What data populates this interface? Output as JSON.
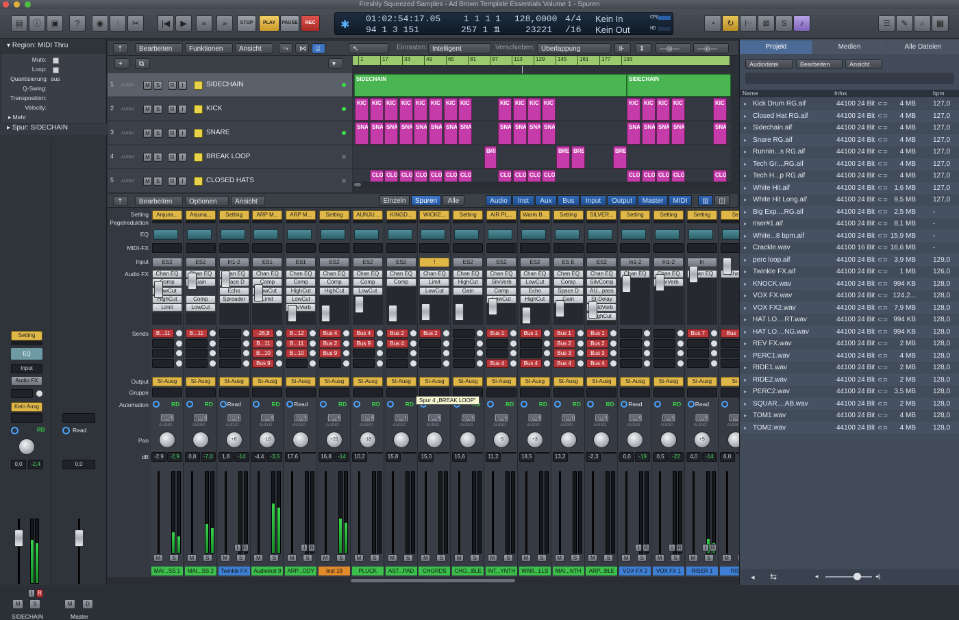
{
  "window": {
    "title": "Freshly Squeezed Samples - Ad Brown Template Essentials Volume 1 - Spuren"
  },
  "transport": {
    "stop": "STOP",
    "play": "PLAY",
    "pause": "PAUSE",
    "rec": "REC",
    "time": "01:02:54:17.05",
    "bars": "94 1 3 151",
    "pos_a": "1 1 1",
    "pos_a2": "1",
    "pos_b": "257 1 1",
    "pos_b2": "1",
    "tempo": "128,0000",
    "sample": "23221",
    "sig": "4/4",
    "div": "/16",
    "in": "Kein In",
    "out": "Kein Out",
    "cpu": "CPU",
    "hd": "HD"
  },
  "inspector": {
    "region_title": "Region: MIDI Thru",
    "mute": "Mute:",
    "loop": "Loop:",
    "quant": "Quantisierung",
    "quant_val": "aus",
    "qswing": "Q-Swing:",
    "transp": "Transposition:",
    "velocity": "Velocity:",
    "more": "Mehr",
    "track_title": "Spur: SIDECHAIN",
    "setting": "Setting",
    "eq": "EQ",
    "input": "Input",
    "audiofx": "Audio FX",
    "output": "Kein Ausg",
    "rd": "RD",
    "read": "Read",
    "vol1": "0,0",
    "vol1b": "-2,4",
    "vol2": "0,0",
    "m": "M",
    "s": "S",
    "d": "D",
    "i": "I",
    "r": "R",
    "name1": "SIDECHAIN",
    "name2": "Master"
  },
  "tracks_toolbar": {
    "edit": "Bearbeiten",
    "functions": "Funktionen",
    "view": "Ansicht",
    "snap_label": "Einrasten:",
    "snap_val": "Intelligent",
    "move_label": "Verschieben:",
    "move_val": "Überlappung"
  },
  "ruler": [
    "1",
    "17",
    "33",
    "49",
    "65",
    "81",
    "97",
    "113",
    "129",
    "145",
    "161",
    "177",
    "193"
  ],
  "tracks": [
    {
      "num": "1",
      "name": "SIDECHAIN"
    },
    {
      "num": "2",
      "name": "KICK"
    },
    {
      "num": "3",
      "name": "SNARE"
    },
    {
      "num": "4",
      "name": "BREAK LOOP"
    },
    {
      "num": "5",
      "name": "CLOSED HATS"
    }
  ],
  "track_btns": {
    "m": "M",
    "s": "S",
    "r": "R",
    "i": "I",
    "audio": "AUDIO"
  },
  "regions": {
    "sidechain": "SIDECHAIN",
    "kick": "KIC",
    "snare": "SNA",
    "brk": "BRE",
    "clo": "CLO",
    "bri": "BRI"
  },
  "mixer_toolbar": {
    "edit": "Bearbeiten",
    "options": "Optionen",
    "view": "Ansicht",
    "single": "Einzeln",
    "tracks": "Spuren",
    "all": "Alle",
    "f_audio": "Audio",
    "f_inst": "Inst",
    "f_aux": "Aux",
    "f_bus": "Bus",
    "f_input": "Input",
    "f_output": "Output",
    "f_master": "Master",
    "f_midi": "MIDI"
  },
  "mixer_rows": {
    "setting": "Setting",
    "gain": "Pegelreduktion",
    "eq": "EQ",
    "midifx": "MIDI-FX",
    "input": "Input",
    "audiofx": "Audio FX",
    "sends": "Sends",
    "output": "Output",
    "group": "Gruppe",
    "automation": "Automation",
    "pan": "Pan",
    "db": "dB"
  },
  "strips": [
    {
      "setting": "Anjuna...",
      "input": "ES2",
      "fx": [
        "Chan EQ",
        "Comp",
        "LowCut",
        "HighCut",
        "Limit"
      ],
      "sends": [
        "B...11",
        "",
        "",
        ""
      ],
      "out": "St-Ausg",
      "auto": "RD",
      "pan": "",
      "db1": "-2,9",
      "db2": "-2,9",
      "name": "MAI...SS 1",
      "color": "#3cbf4a"
    },
    {
      "setting": "Anjuna...",
      "input": "ES2",
      "fx": [
        "Chan EQ",
        "Gain",
        "",
        "Comp",
        "LowCut"
      ],
      "sends": [
        "B...11",
        "",
        "",
        ""
      ],
      "out": "St-Ausg",
      "auto": "RD",
      "pan": "",
      "db1": "0,8",
      "db2": "-7,0",
      "name": "MAI...SS 2",
      "color": "#3cbf4a"
    },
    {
      "setting": "Setting",
      "input": "In1-2",
      "fx": [
        "Chan EQ",
        "Space D",
        "Echo",
        "Spreader"
      ],
      "sends": [
        "",
        "",
        "",
        ""
      ],
      "out": "St-Ausg",
      "auto": "Read",
      "pan": "+6",
      "db1": "1,8",
      "db2": "-14",
      "name": "Twinkle FX",
      "color": "#3e7fd6"
    },
    {
      "setting": "ARP M...",
      "input": "ES1",
      "fx": [
        "Chan EQ",
        "Comp",
        "LowCut",
        "Limit"
      ],
      "sends": [
        "-26,8",
        "B...11",
        "B...10",
        "Bus 9"
      ],
      "out": "St-Ausg",
      "auto": "RD",
      "pan": "-10",
      "db1": "-4,4",
      "db2": "-3,5",
      "name": "AudioInst 9",
      "color": "#3cbf4a"
    },
    {
      "setting": "ARP M...",
      "input": "ES1",
      "fx": [
        "Chan EQ",
        "Comp",
        "HighCut",
        "LowCut",
        "SilvVerb"
      ],
      "sends": [
        "B...12",
        "B...11",
        "B...10",
        ""
      ],
      "out": "St-Ausg",
      "auto": "Read",
      "pan": "",
      "db1": "17,6",
      "db2": "",
      "name": "ARP...ODY",
      "color": "#3cbf4a"
    },
    {
      "setting": "Setting",
      "input": "ES2",
      "fx": [
        "Chan EQ",
        "Comp",
        "HighCut"
      ],
      "sends": [
        "Bus 4",
        "Bus 2",
        "Bus 9",
        ""
      ],
      "out": "St-Ausg",
      "auto": "RD",
      "pan": "+21",
      "db1": "16,8",
      "db2": "-14",
      "name": "Inst 19",
      "color": "#e08a2a"
    },
    {
      "setting": "AUNJU...",
      "input": "ES2",
      "fx": [
        "Chan EQ",
        "Comp",
        "LowCut"
      ],
      "sends": [
        "Bus 4",
        "Bus 9",
        "",
        ""
      ],
      "out": "St-Ausg",
      "auto": "RD",
      "pan": "-18",
      "db1": "10,2",
      "db2": "",
      "name": "PLUCK",
      "color": "#3cbf4a"
    },
    {
      "setting": "KINGD...",
      "input": "ES2",
      "fx": [
        "Chan EQ",
        "Comp"
      ],
      "sends": [
        "Bus 2",
        "Bus 4",
        "",
        ""
      ],
      "out": "St-Ausg",
      "auto": "RD",
      "pan": "",
      "db1": "15,8",
      "db2": "",
      "name": "AST...PAD",
      "color": "#3cbf4a"
    },
    {
      "setting": "WICKE...",
      "input": "!",
      "fx": [
        "Chan EQ",
        "Limit",
        "LowCut"
      ],
      "sends": [
        "Bus 2",
        "",
        "",
        ""
      ],
      "out": "St-Ausg",
      "auto": "",
      "pan": "",
      "db1": "15,0",
      "db2": "",
      "name": "CHORDS",
      "color": "#3cbf4a"
    },
    {
      "setting": "Setting",
      "input": "ES2",
      "fx": [
        "Chan EQ",
        "HighCut",
        "Gain"
      ],
      "sends": [
        "",
        "",
        "",
        ""
      ],
      "out": "St-Ausg",
      "auto": "RD",
      "pan": "",
      "db1": "15,6",
      "db2": "",
      "name": "CHO...BLE",
      "color": "#3cbf4a"
    },
    {
      "setting": "AIR PL...",
      "input": "ES2",
      "fx": [
        "Chan EQ",
        "SilvVerb",
        "Comp",
        "LowCut"
      ],
      "sends": [
        "Bus 1",
        "",
        "",
        "Bus 4"
      ],
      "out": "St-Ausg",
      "auto": "RD",
      "pan": "-5",
      "db1": "11,2",
      "db2": "",
      "name": "INT...YNTH",
      "color": "#3cbf4a"
    },
    {
      "setting": "Warm B...",
      "input": "ES2",
      "fx": [
        "Chan EQ",
        "LowCut",
        "Echo",
        "HighCut"
      ],
      "sends": [
        "Bus 1",
        "",
        "",
        "Bus 4"
      ],
      "out": "St-Ausg",
      "auto": "RD",
      "pan": "+3",
      "db1": "18,5",
      "db2": "",
      "name": "WAR...LLS",
      "color": "#3cbf4a"
    },
    {
      "setting": "Setting",
      "input": "ES E",
      "fx": [
        "Chan EQ",
        "Comp",
        "Space D",
        "Gain"
      ],
      "sends": [
        "Bus 1",
        "Bus 2",
        "Bus 3",
        "Bus 4"
      ],
      "out": "St-Ausg",
      "auto": "RD",
      "pan": "",
      "db1": "13,2",
      "db2": "",
      "name": "MAI...NTH",
      "color": "#3cbf4a"
    },
    {
      "setting": "SILVER...",
      "input": "ES2",
      "fx": [
        "Chan EQ",
        "SilvComp",
        "AU...pass",
        "St-Delay",
        "GoldVerb",
        "HighCut"
      ],
      "sends": [
        "Bus 1",
        "Bus 2",
        "Bus 3",
        "Bus 4"
      ],
      "out": "St-Ausg",
      "auto": "RD",
      "pan": "",
      "db1": "-2,3",
      "db2": "",
      "name": "ARP...BLE",
      "color": "#3cbf4a"
    },
    {
      "setting": "Setting",
      "input": "In1-2",
      "fx": [
        "Chan EQ"
      ],
      "sends": [
        "",
        "",
        "",
        ""
      ],
      "out": "St-Ausg",
      "auto": "Read",
      "pan": "",
      "db1": "0,0",
      "db2": "-19",
      "name": "VOX FX 2",
      "color": "#3e7fd6"
    },
    {
      "setting": "Setting",
      "input": "In1-2",
      "fx": [
        "Chan EQ",
        "SilvVerb"
      ],
      "sends": [
        "",
        "",
        "",
        ""
      ],
      "out": "St-Ausg",
      "auto": "RD",
      "pan": "",
      "db1": "0,5",
      "db2": "-22",
      "name": "VOX FX 1",
      "color": "#3e7fd6"
    },
    {
      "setting": "Setting",
      "input": "In",
      "fx": [
        "Chan EQ"
      ],
      "sends": [
        "Bus 7",
        "",
        "",
        ""
      ],
      "out": "St-Ausg",
      "auto": "Read",
      "pan": "+5",
      "db1": "4,0",
      "db2": "-14",
      "name": "RISER 1",
      "color": "#3e7fd6"
    },
    {
      "setting": "Se",
      "input": "",
      "fx": [
        "Chan"
      ],
      "sends": [
        "Bus",
        "",
        "",
        ""
      ],
      "out": "St-",
      "auto": "",
      "pan": "",
      "db1": "6,0",
      "db2": "",
      "name": "RIS",
      "color": "#3e7fd6"
    }
  ],
  "strip_btns": {
    "m": "M",
    "s": "S",
    "i": "I",
    "r": "R",
    "audio": "AUDIO",
    "midi": "MIDI"
  },
  "tooltip": "Spur 4 „BREAK LOOP“",
  "browser": {
    "tabs": [
      "Projekt",
      "Medien",
      "Alle Dateien"
    ],
    "menus": [
      "Audiodatei",
      "Bearbeiten",
      "Ansicht"
    ],
    "cols": [
      "Name",
      "Infos",
      "bpm"
    ],
    "files": [
      {
        "name": "Kick Drum RG.aif",
        "info": "44100 24 Bit",
        "size": "4 MB",
        "bpm": "127,0"
      },
      {
        "name": "Closed Hat RG.aif",
        "info": "44100 24 Bit",
        "size": "4 MB",
        "bpm": "127,0"
      },
      {
        "name": "Sidechain.aif",
        "info": "44100 24 Bit",
        "size": "4 MB",
        "bpm": "127,0"
      },
      {
        "name": "Snare RG.aif",
        "info": "44100 24 Bit",
        "size": "4 MB",
        "bpm": "127,0"
      },
      {
        "name": "Runnin...s RG.aif",
        "info": "44100 24 Bit",
        "size": "4 MB",
        "bpm": "127,0"
      },
      {
        "name": "Tech Gr....RG.aif",
        "info": "44100 24 Bit",
        "size": "4 MB",
        "bpm": "127,0"
      },
      {
        "name": "Tech H...p RG.aif",
        "info": "44100 24 Bit",
        "size": "4 MB",
        "bpm": "127,0"
      },
      {
        "name": "White Hit.aif",
        "info": "44100 24 Bit",
        "size": "1,6 MB",
        "bpm": "127,0"
      },
      {
        "name": "White Hit Long.aif",
        "info": "44100 24 Bit",
        "size": "9,5 MB",
        "bpm": "127,0"
      },
      {
        "name": "Big Exp....RG.aif",
        "info": "44100 24 Bit",
        "size": "2,5 MB",
        "bpm": "-"
      },
      {
        "name": "riser#1.aif",
        "info": "44100 24 Bit",
        "size": "8,1 MB",
        "bpm": "-"
      },
      {
        "name": "White...8 bpm.aif",
        "info": "44100 24 Bit",
        "size": "15,9 MB",
        "bpm": "-"
      },
      {
        "name": "Crackle.wav",
        "info": "44100 16 Bit",
        "size": "16,6 MB",
        "bpm": "-"
      },
      {
        "name": "perc loop.aif",
        "info": "44100 24 Bit",
        "size": "3,9 MB",
        "bpm": "129,0"
      },
      {
        "name": "Twinkle FX.aif",
        "info": "44100 24 Bit",
        "size": "1 MB",
        "bpm": "126,0"
      },
      {
        "name": "KNOCK.wav",
        "info": "44100 24 Bit",
        "size": "994 KB",
        "bpm": "128,0"
      },
      {
        "name": "VOX FX.wav",
        "info": "44100 24 Bit",
        "size": "124,2...",
        "bpm": "128,0"
      },
      {
        "name": "VOX FX2.wav",
        "info": "44100 24 Bit",
        "size": "7,9 MB",
        "bpm": "128,0"
      },
      {
        "name": "HAT LO....RT.wav",
        "info": "44100 24 Bit",
        "size": "994 KB",
        "bpm": "128,0"
      },
      {
        "name": "HAT LO....NG.wav",
        "info": "44100 24 Bit",
        "size": "994 KB",
        "bpm": "128,0"
      },
      {
        "name": "REV FX.wav",
        "info": "44100 24 Bit",
        "size": "2 MB",
        "bpm": "128,0"
      },
      {
        "name": "PERC1.wav",
        "info": "44100 24 Bit",
        "size": "4 MB",
        "bpm": "128,0"
      },
      {
        "name": "RIDE1.wav",
        "info": "44100 24 Bit",
        "size": "2 MB",
        "bpm": "128,0"
      },
      {
        "name": "RIDE2.wav",
        "info": "44100 24 Bit",
        "size": "2 MB",
        "bpm": "128,0"
      },
      {
        "name": "PERC2.wav",
        "info": "44100 24 Bit",
        "size": "3,5 MB",
        "bpm": "128,0"
      },
      {
        "name": "SQUAR....AB.wav",
        "info": "44100 24 Bit",
        "size": "2 MB",
        "bpm": "128,0"
      },
      {
        "name": "TOM1.wav",
        "info": "44100 24 Bit",
        "size": "4 MB",
        "bpm": "128,0"
      },
      {
        "name": "TOM2.wav",
        "info": "44100 24 Bit",
        "size": "4 MB",
        "bpm": "128,0"
      }
    ]
  }
}
